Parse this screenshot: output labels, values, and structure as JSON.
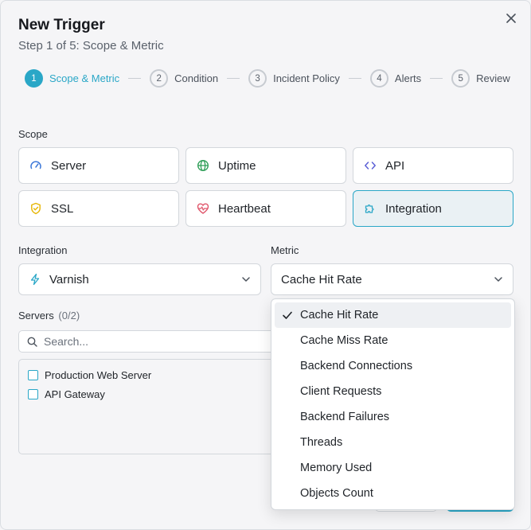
{
  "modal": {
    "title": "New Trigger",
    "subtitle": "Step 1 of 5: Scope & Metric",
    "close_icon": "close-icon"
  },
  "steps": [
    {
      "num": "1",
      "label": "Scope & Metric",
      "active": true
    },
    {
      "num": "2",
      "label": "Condition",
      "active": false
    },
    {
      "num": "3",
      "label": "Incident Policy",
      "active": false
    },
    {
      "num": "4",
      "label": "Alerts",
      "active": false
    },
    {
      "num": "5",
      "label": "Review",
      "active": false
    }
  ],
  "scope": {
    "label": "Scope",
    "options": [
      {
        "label": "Server",
        "icon": "gauge-icon"
      },
      {
        "label": "Uptime",
        "icon": "globe-icon"
      },
      {
        "label": "API",
        "icon": "code-icon"
      },
      {
        "label": "SSL",
        "icon": "shield-icon"
      },
      {
        "label": "Heartbeat",
        "icon": "heartbeat-icon"
      },
      {
        "label": "Integration",
        "icon": "puzzle-icon",
        "selected": true
      }
    ]
  },
  "integration": {
    "label": "Integration",
    "value": "Varnish",
    "icon": "lightning-icon"
  },
  "metric": {
    "label": "Metric",
    "value": "Cache Hit Rate",
    "options": [
      "Cache Hit Rate",
      "Cache Miss Rate",
      "Backend Connections",
      "Client Requests",
      "Backend Failures",
      "Threads",
      "Memory Used",
      "Objects Count"
    ]
  },
  "servers": {
    "label": "Servers",
    "count": "(0/2)",
    "search_placeholder": "Search...",
    "items": [
      "Production Web Server",
      "API Gateway"
    ]
  },
  "colors": {
    "accent": "#2aa7c7",
    "heartbeat": "#e0566b",
    "shield": "#e6b400",
    "globe": "#2f9e58",
    "gauge": "#3a76d8",
    "code": "#5b5fd6"
  }
}
